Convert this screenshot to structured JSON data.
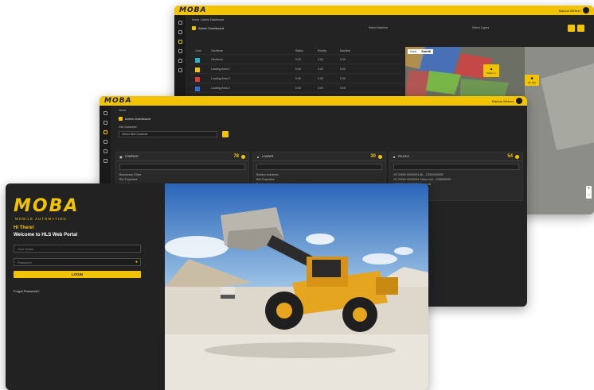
{
  "back_window": {
    "logo": "MOBA",
    "user": "Markus Wehrer",
    "breadcrumb": "Home / Admin Dashboard",
    "title": "Admin Dashboard",
    "filter_left": "Select Machine",
    "filter_right": "Select Layers",
    "map_tabs": [
      "Karte",
      "Satellit"
    ],
    "map_label_1": "Station 1",
    "map_label_2": "Ob Wei",
    "table_headers": [
      "Color",
      "Geofence",
      "Status",
      "Priority",
      "Machine"
    ],
    "rows": [
      {
        "color": "#23b5c9",
        "name": "Geofence",
        "c1": "0.00",
        "c2": "0.00",
        "c3": "0.00"
      },
      {
        "color": "#f2c400",
        "name": "Loading Area 1",
        "c1": "0.00",
        "c2": "0.00",
        "c3": "0.00"
      },
      {
        "color": "#e53935",
        "name": "Loading Area 2",
        "c1": "0.00",
        "c2": "0.00",
        "c3": "0.00"
      },
      {
        "color": "#2f6fd6",
        "name": "Loading Area 3",
        "c1": "0.00",
        "c2": "0.00",
        "c3": "0.00"
      },
      {
        "color": "#7ccf3d",
        "name": "Loading Area 4",
        "c1": "0.00",
        "c2": "0.00",
        "c3": "0.00"
      }
    ]
  },
  "middle_window": {
    "logo": "MOBA",
    "user": "Markus Wehrer",
    "breadcrumb": "Home",
    "title": "Admin Dashboard",
    "select_label": "Gen Customer",
    "select_value": "Select 360 Customer",
    "panels": [
      {
        "title": "COMPANY",
        "count": "78",
        "items": [
          "Bouwcomp Glass",
          "BW Properties",
          "Maltie Company"
        ]
      },
      {
        "title": "LOADER",
        "count": "30",
        "items": [
          "Bulldoo Industries",
          "BW Properties",
          "Bernhard"
        ]
      },
      {
        "title": "TRUCKS",
        "count": "54",
        "items": [
          "VG 20000 00000001 Alt - 17000/000000",
          "VG 20000 00000001 Carry Loot - 1700000000",
          "VG 20000 00000001 Carry Alt"
        ]
      }
    ]
  },
  "front_window": {
    "logo": "MOBA",
    "tagline": "MOBILE AUTOMATION",
    "greeting": "Hi There!",
    "welcome": "Welcome to HLS Web Portal",
    "username_placeholder": "User Name",
    "password_placeholder": "Password",
    "login_label": "LOGIN",
    "forgot_label": "Forgot Password?"
  },
  "colors": {
    "accent": "#f2c400",
    "dark": "#222222"
  }
}
